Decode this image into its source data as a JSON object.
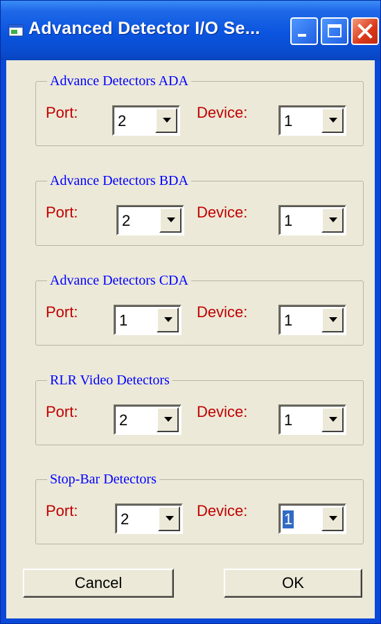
{
  "window": {
    "title": "Advanced Detector I/O Se...",
    "controls": [
      "minimize-icon",
      "maximize-icon",
      "close-icon"
    ]
  },
  "groups": [
    {
      "title": "Advance Detectors ADA",
      "port_label": "Port:",
      "port_value": "2",
      "device_label": "Device:",
      "device_value": "1"
    },
    {
      "title": "Advance Detectors BDA",
      "port_label": "Port:",
      "port_value": "2",
      "device_label": "Device:",
      "device_value": "1"
    },
    {
      "title": "Advance Detectors CDA",
      "port_label": "Port:",
      "port_value": "1",
      "device_label": "Device:",
      "device_value": "1"
    },
    {
      "title": "RLR Video Detectors",
      "port_label": "Port:",
      "port_value": "2",
      "device_label": "Device:",
      "device_value": "1"
    },
    {
      "title": "Stop-Bar Detectors",
      "port_label": "Port:",
      "port_value": "2",
      "device_label": "Device:",
      "device_value": "1"
    }
  ],
  "buttons": {
    "cancel": "Cancel",
    "ok": "OK"
  },
  "colors": {
    "title_bar": "#0a54df",
    "group_title": "#0000ff",
    "field_label": "#c00000",
    "dialog_face": "#ece9d8",
    "selection": "#316ac5"
  }
}
